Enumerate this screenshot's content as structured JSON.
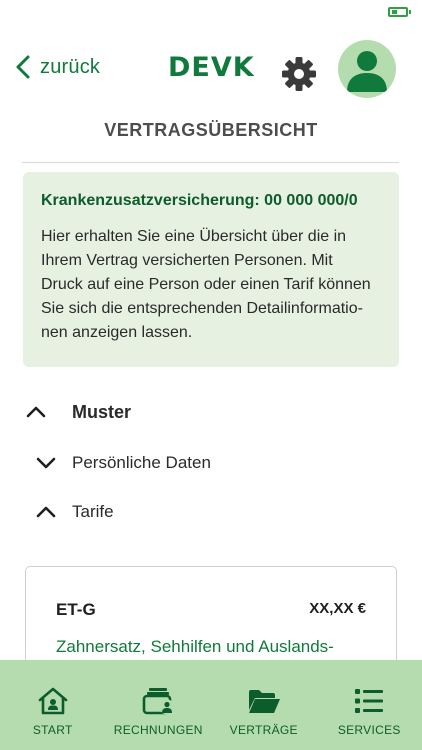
{
  "header": {
    "back_label": "zurück",
    "logo_text": "DEVK",
    "settings_icon": "gear-icon",
    "profile_icon": "user-avatar-icon"
  },
  "page": {
    "title": "VERTRAGSÜBERSICHT"
  },
  "info_box": {
    "heading": "Krankenzusatzversicherung: 00 000 000/0",
    "text": "Hier erhalten Sie eine Übersicht über die in\nIhrem Vertrag versicherten Personen. Mit\nDruck auf eine Person oder einen Tarif können\nSie sich die entsprechenden Detailinformatio-\nnen anzeigen lassen."
  },
  "sections": {
    "person": {
      "label": "Muster",
      "state": "expanded"
    },
    "personal_data": {
      "label": "Persönliche Daten",
      "state": "collapsed"
    },
    "tariffs": {
      "label": "Tarife",
      "state": "expanded"
    }
  },
  "tariff_card": {
    "name": "ET-G",
    "price": "XX,XX €",
    "description": "Zahnersatz, Sehhilfen und Auslands-"
  },
  "tabbar": {
    "items": [
      {
        "label": "START",
        "icon": "home-icon"
      },
      {
        "label": "RECHNUNGEN",
        "icon": "wallet-user-icon"
      },
      {
        "label": "VERTRÄGE",
        "icon": "folder-open-icon"
      },
      {
        "label": "SERVICES",
        "icon": "list-icon"
      }
    ]
  },
  "colors": {
    "brand_green": "#0f7a3b",
    "tabbar_bg": "#b5dcae",
    "info_bg": "#e6f1e2"
  }
}
